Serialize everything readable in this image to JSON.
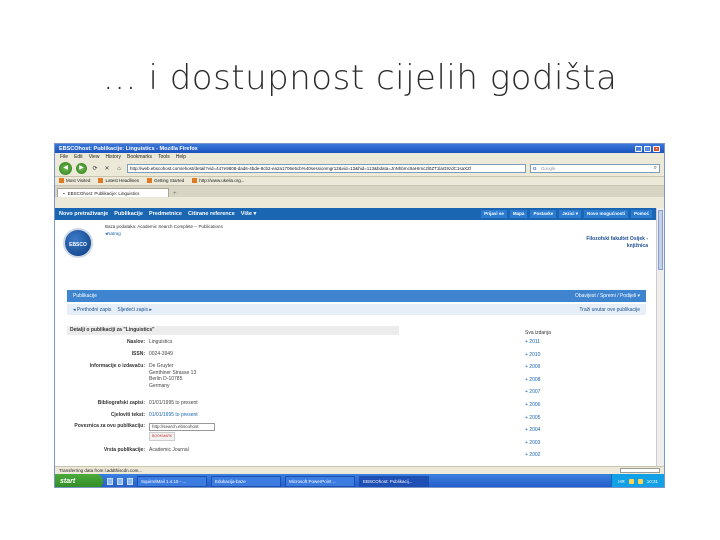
{
  "slide": {
    "title": "… i dostupnost cijelih godišta"
  },
  "window": {
    "title": "EBSCOhost: Publikacije: Linguistics - Mozilla Firefox"
  },
  "menu": [
    "File",
    "Edit",
    "View",
    "History",
    "Bookmarks",
    "Tools",
    "Help"
  ],
  "navbar": {
    "url": "http://web.ebscohost.com/ehost/detail?vid=447e9808-dad6-4bde-8cb2-ea2a1706e5cb%40sessionmgr12&vid=13&hid=113&bdata=JnNhbmc9aHImc2l0ZT1laG9zdC1saXZl",
    "search_engine": "G",
    "search_placeholder": "Google"
  },
  "bookmarks": [
    "Most Visited",
    "Latest Headlines",
    "Getting Started",
    "http://www.ukeila.org..."
  ],
  "tab": {
    "label": "EBSCOhost: Publikacije: Linguistics",
    "plus": "+"
  },
  "ebsco_nav": {
    "items": [
      "Novo pretraživanje",
      "Publikacije",
      "Predmetnice",
      "Citirane reference",
      "Više ▾"
    ],
    "right": [
      "Prijavi se",
      "Mapa",
      "Postavke",
      "Jezici ▾",
      "Novo mogućnosti",
      "Pomoć"
    ]
  },
  "header": {
    "logo": "EBSCO",
    "db_info": "Baza podataka: Academic Search Complete -- Publications",
    "back_link": "◂Natrag",
    "institution": "Filozofski fakultet Osijek - knjižnica"
  },
  "pub_bar": {
    "label": "Publikacije",
    "right": "Obavijest / Spremi / Podijeli ▾"
  },
  "rec_nav": {
    "prev": "◂ Prethodni zapis",
    "next": "Sljedeći zapis ▸",
    "search_within": "Traži unutar ove publikacije"
  },
  "details": {
    "heading": "Detalji o publikaciji za \"Linguistics\"",
    "rows": [
      {
        "label": "Naslov:",
        "value": "Linguistics"
      },
      {
        "label": "ISSN:",
        "value": "0024-3949"
      },
      {
        "label": "Informacije o izdavaču:",
        "value_lines": [
          "De Gruyter",
          "Genthiner Strasse 13",
          "Berlin D-10785",
          "Germany"
        ]
      },
      {
        "label": "Bibliografski zapisi:",
        "value": "01/01/1995 to present"
      },
      {
        "label": "Cjeloviti tekst:",
        "value": "01/01/1995 to present"
      },
      {
        "label": "Poveznica za ovu publikaciju:",
        "value": "http://search.ebscohost",
        "badge": "BOOKMARK"
      },
      {
        "label": "Vrsta publikacije:",
        "value": "Academic Journal"
      }
    ]
  },
  "years": {
    "heading": "Sva izdanja",
    "items": [
      "+ 2011",
      "+ 2010",
      "+ 2009",
      "+ 2008",
      "+ 2007",
      "+ 2006",
      "+ 2005",
      "+ 2004",
      "+ 2003",
      "+ 2002"
    ]
  },
  "status": {
    "text": "Transferring data from l.addthiscdn.com..."
  },
  "taskbar": {
    "start": "start",
    "tasks": [
      "SquirrelMail 1.4.15 - ...",
      "Edukacija-baze",
      "Microsoft PowerPoint ...",
      "EBSCOhost: Publikacij..."
    ],
    "tray_lang": "HR",
    "clock": "10:31"
  },
  "colors": {
    "ebsco_blue": "#1b66b3",
    "xp_blue": "#2258c8",
    "start_green": "#2f8a22"
  }
}
